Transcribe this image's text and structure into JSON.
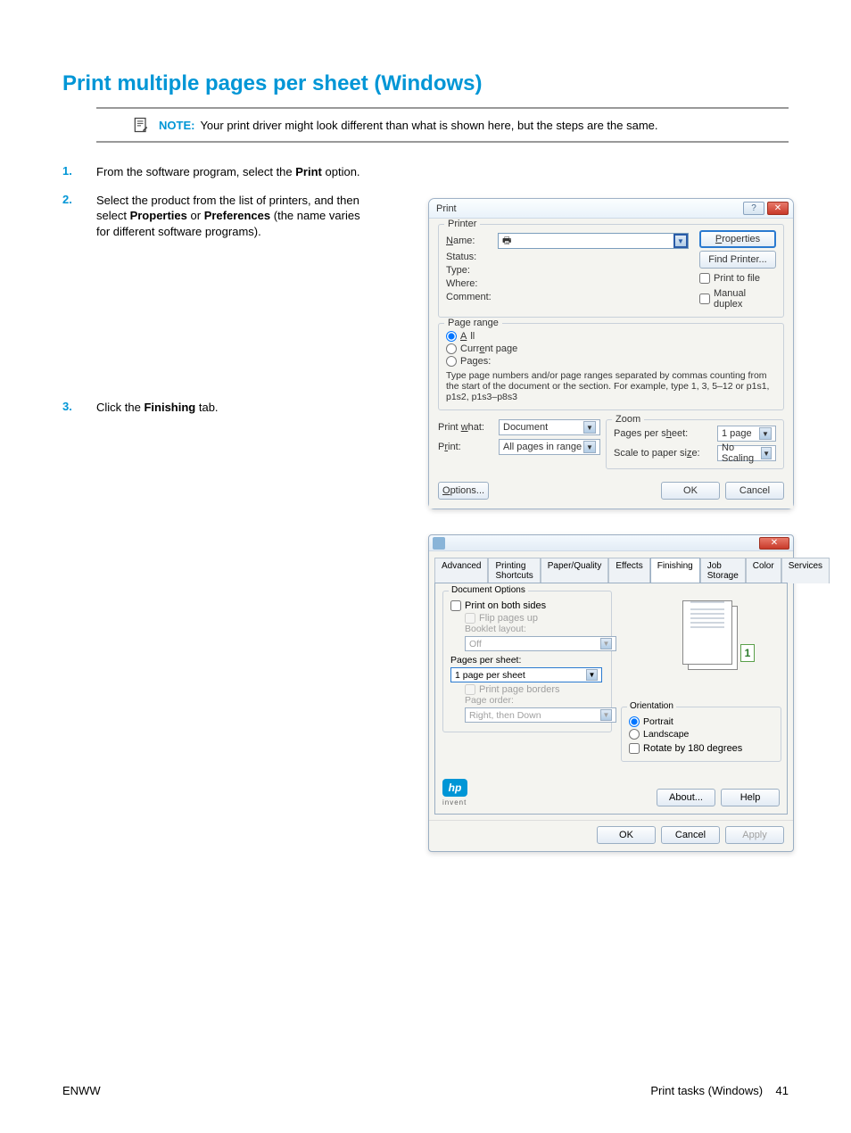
{
  "page": {
    "title": "Print multiple pages per sheet (Windows)",
    "note_label": "NOTE:",
    "note_text": "Your print driver might look different than what is shown here, but the steps are the same."
  },
  "steps": {
    "s1": {
      "num": "1.",
      "pre": "From the software program, select the ",
      "b1": "Print",
      "post": " option."
    },
    "s2": {
      "num": "2.",
      "pre": "Select the product from the list of printers, and then select ",
      "b1": "Properties",
      "mid": " or ",
      "b2": "Preferences",
      "post": " (the name varies for different software programs)."
    },
    "s3": {
      "num": "3.",
      "pre": "Click the ",
      "b1": "Finishing",
      "post": " tab."
    }
  },
  "dlg1": {
    "title": "Print",
    "printer_legend": "Printer",
    "name_lbl": "Name:",
    "status_lbl": "Status:",
    "type_lbl": "Type:",
    "where_lbl": "Where:",
    "comment_lbl": "Comment:",
    "properties_btn": "Properties",
    "find_btn": "Find Printer...",
    "print_to_file": "Print to file",
    "manual_duplex": "Manual duplex",
    "range_legend": "Page range",
    "all": "All",
    "current": "Current page",
    "pages": "Pages:",
    "range_help1": "Type page numbers and/or page ranges separated by commas counting from the start of the document or the section. For example, type 1, 3, 5–12 or p1s1, p1s2, p1s3–p8s3",
    "print_what_lbl": "Print what:",
    "print_what_val": "Document",
    "print_lbl": "Print:",
    "print_val": "All pages in range",
    "zoom_legend": "Zoom",
    "pps_lbl": "Pages per sheet:",
    "pps_val": "1 page",
    "scale_lbl": "Scale to paper size:",
    "scale_val": "No Scaling",
    "options_btn": "Options...",
    "ok_btn": "OK",
    "cancel_btn": "Cancel"
  },
  "dlg2": {
    "tabs": {
      "advanced": "Advanced",
      "shortcuts": "Printing Shortcuts",
      "paper": "Paper/Quality",
      "effects": "Effects",
      "finishing": "Finishing",
      "job": "Job Storage",
      "color": "Color",
      "services": "Services"
    },
    "doc_opts_legend": "Document Options",
    "both_sides": "Print on both sides",
    "flip": "Flip pages up",
    "booklet_lbl": "Booklet layout:",
    "booklet_val": "Off",
    "pps_lbl": "Pages per sheet:",
    "pps_val": "1 page per sheet",
    "borders": "Print page borders",
    "order_lbl": "Page order:",
    "order_val": "Right, then Down",
    "orient_legend": "Orientation",
    "portrait": "Portrait",
    "landscape": "Landscape",
    "rotate": "Rotate by 180 degrees",
    "preview_num": "1",
    "hp": "hp",
    "invent": "invent",
    "about": "About...",
    "help": "Help",
    "ok": "OK",
    "cancel": "Cancel",
    "apply": "Apply"
  },
  "footer": {
    "left": "ENWW",
    "right_label": "Print tasks (Windows)",
    "page_num": "41"
  }
}
